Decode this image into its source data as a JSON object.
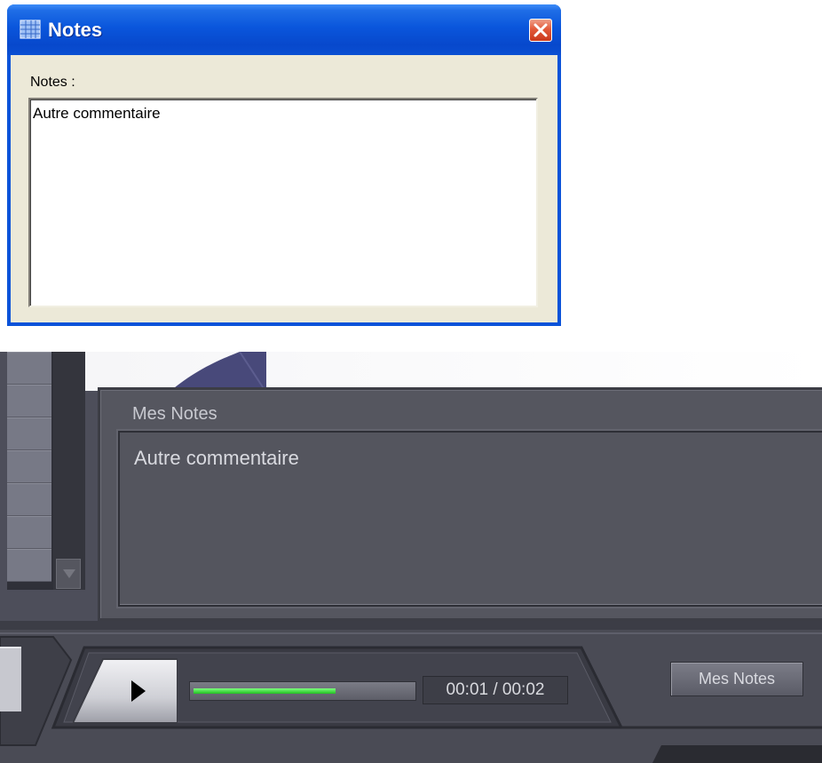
{
  "dialog": {
    "title": "Notes",
    "label": "Notes :",
    "text_value": "Autre commentaire",
    "icons": {
      "app": "table-icon",
      "close": "close-icon"
    }
  },
  "player": {
    "notes_header": "Mes Notes",
    "notes_text": "Autre commentaire",
    "time_display": "00:01 / 00:02",
    "progress_fraction": 0.65,
    "mes_notes_button": "Mes Notes",
    "icons": {
      "play": "play-icon",
      "scroll_down": "chevron-down-icon"
    }
  },
  "colors": {
    "xp_title_blue": "#0a56dc",
    "xp_close_red": "#e2593a",
    "player_bg": "#4d4e5a",
    "progress_green": "#2fd02f"
  }
}
